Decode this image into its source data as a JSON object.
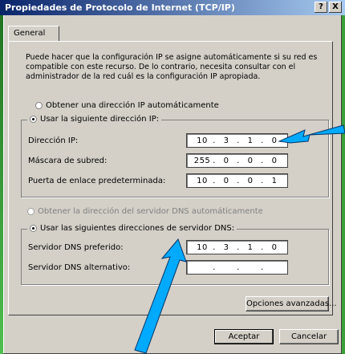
{
  "window": {
    "title": "Propiedades de Protocolo de Internet (TCP/IP)",
    "help_label": "?",
    "close_label": "X"
  },
  "tab": {
    "label": "General"
  },
  "description": "Puede hacer que la configuración IP se asigne automáticamente si su red es compatible con este recurso. De lo contrario, necesita consultar con el administrador de la red cuál es la configuración IP apropiada.",
  "ip_section": {
    "auto_radio": "Obtener una dirección IP automáticamente",
    "manual_radio": "Usar la siguiente dirección IP:",
    "fields": [
      {
        "label": "Dirección IP:",
        "value": [
          "10",
          "3",
          "1",
          "0"
        ]
      },
      {
        "label": "Máscara de subred:",
        "value": [
          "255",
          "0",
          "0",
          "0"
        ]
      },
      {
        "label": "Puerta de enlace predeterminada:",
        "value": [
          "10",
          "0",
          "0",
          "1"
        ]
      }
    ]
  },
  "dns_section": {
    "auto_radio": "Obtener la dirección del servidor DNS automáticamente",
    "manual_radio": "Usar las siguientes direcciones de servidor DNS:",
    "fields": [
      {
        "label": "Servidor DNS preferido:",
        "value": [
          "10",
          "3",
          "1",
          "0"
        ]
      },
      {
        "label": "Servidor DNS alternativo:",
        "value": [
          "",
          "",
          "",
          ""
        ]
      }
    ]
  },
  "buttons": {
    "advanced": "Opciones avanzadas...",
    "ok": "Aceptar",
    "cancel": "Cancelar"
  },
  "colors": {
    "arrow": "#00aaff",
    "titlebar_start": "#0a246a",
    "background": "#3aa03a"
  }
}
